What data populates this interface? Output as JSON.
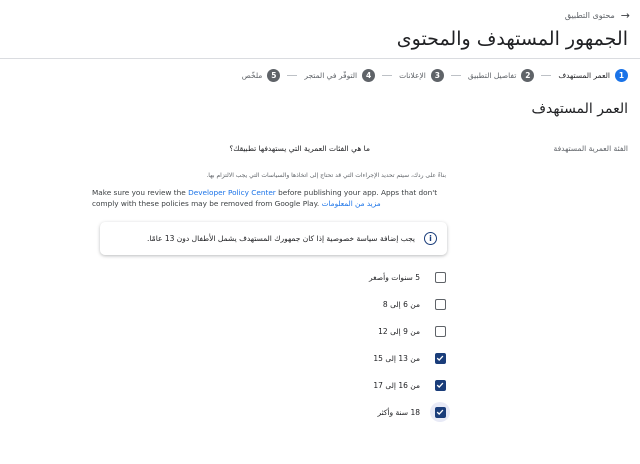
{
  "header": {
    "back_label": "محتوى التطبيق",
    "title": "الجمهور المستهدف والمحتوى"
  },
  "steps": [
    {
      "num": "1",
      "label": "العمر المستهدف",
      "active": true
    },
    {
      "num": "2",
      "label": "تفاصيل التطبيق"
    },
    {
      "num": "3",
      "label": "الإعلانات"
    },
    {
      "num": "4",
      "label": "التوفّر في المتجر"
    },
    {
      "num": "5",
      "label": "ملخّص"
    }
  ],
  "section": {
    "title": "العمر المستهدف",
    "field_label": "الفئة العمرية المستهدفة",
    "question": "ما هي الفئات العمرية التي يستهدفها تطبيقك؟",
    "helper": "بناءً على ردك، سيتم تحديد الإجراءات التي قد تحتاج إلى اتخاذها والسياسات التي يجب الالتزام بها.",
    "policy_before": "Make sure you review the ",
    "policy_link": "Developer Policy Center",
    "policy_after": " before publishing your app. Apps that don't comply with these policies may be removed from Google Play.",
    "learn_more": "مزيد من المعلومات"
  },
  "info_card": {
    "text": "يجب إضافة سياسة خصوصية إذا كان جمهورك المستهدف يشمل الأطفال دون 13 عامًا."
  },
  "age_options": [
    {
      "label": "5 سنوات وأصغر",
      "checked": false
    },
    {
      "label": "من 6 إلى 8",
      "checked": false
    },
    {
      "label": "من 9 إلى 12",
      "checked": false
    },
    {
      "label": "من 13 إلى 15",
      "checked": true
    },
    {
      "label": "من 16 إلى 17",
      "checked": true
    },
    {
      "label": "18 سنة وأكثر",
      "checked": true,
      "focused": true
    }
  ],
  "colors": {
    "accent": "#1a73e8",
    "checkbox_checked": "#1a3d7a",
    "step_inactive": "#5f6368"
  }
}
